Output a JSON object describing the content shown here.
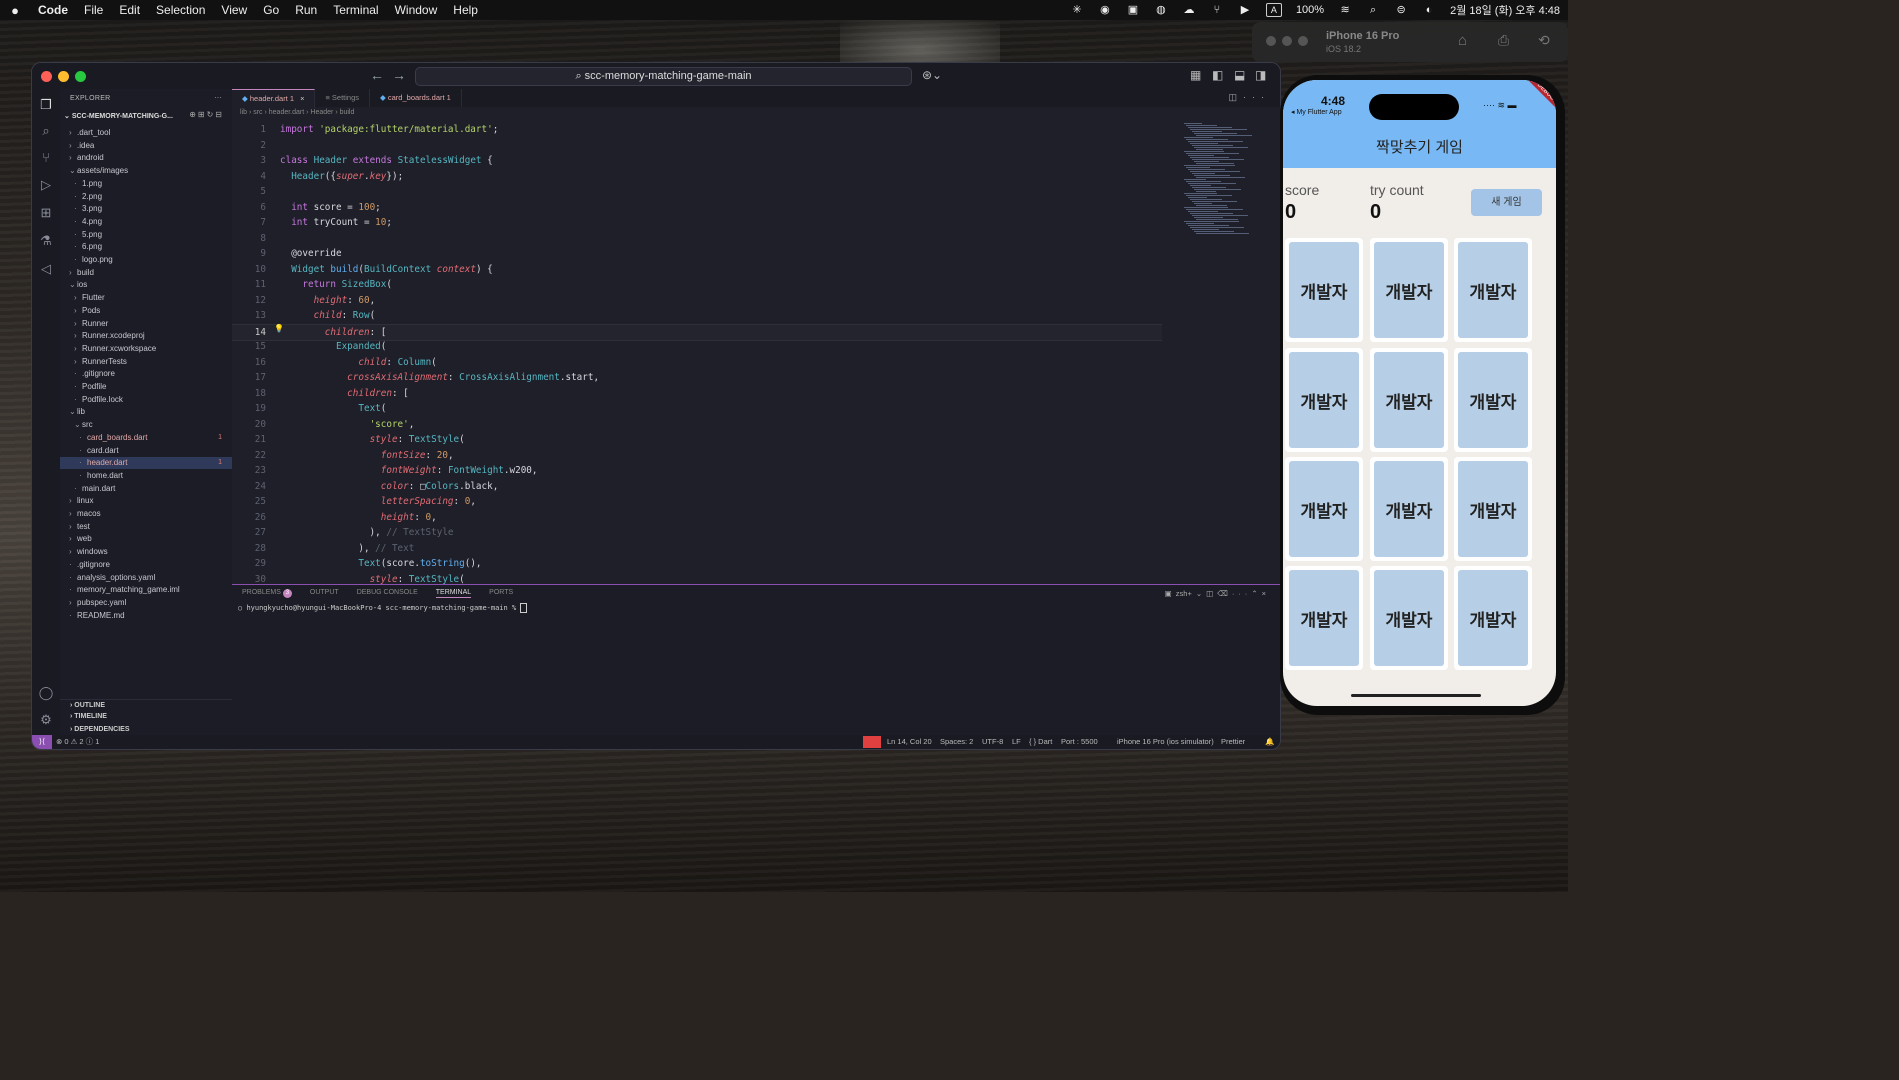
{
  "menubar": {
    "apple": "",
    "items": [
      "Code",
      "File",
      "Edit",
      "Selection",
      "View",
      "Go",
      "Run",
      "Terminal",
      "Window",
      "Help"
    ],
    "battery": "100%",
    "input_mode": "A",
    "datetime": "2월 18일 (화) 오후 4:48"
  },
  "vscode": {
    "command_center": "scc-memory-matching-game-main",
    "explorer_title": "EXPLORER",
    "project": "SCC-MEMORY-MATCHING-G...",
    "tree": [
      {
        "label": ".dart_tool",
        "indent": 1,
        "twisty": "›"
      },
      {
        "label": ".idea",
        "indent": 1,
        "twisty": "›"
      },
      {
        "label": "android",
        "indent": 1,
        "twisty": "›"
      },
      {
        "label": "assets/images",
        "indent": 1,
        "twisty": "⌄"
      },
      {
        "label": "1.png",
        "indent": 2,
        "twisty": ""
      },
      {
        "label": "2.png",
        "indent": 2,
        "twisty": ""
      },
      {
        "label": "3.png",
        "indent": 2,
        "twisty": ""
      },
      {
        "label": "4.png",
        "indent": 2,
        "twisty": ""
      },
      {
        "label": "5.png",
        "indent": 2,
        "twisty": ""
      },
      {
        "label": "6.png",
        "indent": 2,
        "twisty": ""
      },
      {
        "label": "logo.png",
        "indent": 2,
        "twisty": ""
      },
      {
        "label": "build",
        "indent": 1,
        "twisty": "›"
      },
      {
        "label": "ios",
        "indent": 1,
        "twisty": "⌄"
      },
      {
        "label": "Flutter",
        "indent": 2,
        "twisty": "›"
      },
      {
        "label": "Pods",
        "indent": 2,
        "twisty": "›"
      },
      {
        "label": "Runner",
        "indent": 2,
        "twisty": "›"
      },
      {
        "label": "Runner.xcodeproj",
        "indent": 2,
        "twisty": "›"
      },
      {
        "label": "Runner.xcworkspace",
        "indent": 2,
        "twisty": "›"
      },
      {
        "label": "RunnerTests",
        "indent": 2,
        "twisty": "›"
      },
      {
        "label": ".gitignore",
        "indent": 2,
        "twisty": ""
      },
      {
        "label": "Podfile",
        "indent": 2,
        "twisty": ""
      },
      {
        "label": "Podfile.lock",
        "indent": 2,
        "twisty": ""
      },
      {
        "label": "lib",
        "indent": 1,
        "twisty": "⌄"
      },
      {
        "label": "src",
        "indent": 2,
        "twisty": "⌄"
      },
      {
        "label": "card_boards.dart",
        "indent": 3,
        "twisty": "",
        "badge": "1"
      },
      {
        "label": "card.dart",
        "indent": 3,
        "twisty": ""
      },
      {
        "label": "header.dart",
        "indent": 3,
        "twisty": "",
        "badge": "1",
        "selected": true
      },
      {
        "label": "home.dart",
        "indent": 3,
        "twisty": ""
      },
      {
        "label": "main.dart",
        "indent": 2,
        "twisty": ""
      },
      {
        "label": "linux",
        "indent": 1,
        "twisty": "›"
      },
      {
        "label": "macos",
        "indent": 1,
        "twisty": "›"
      },
      {
        "label": "test",
        "indent": 1,
        "twisty": "›"
      },
      {
        "label": "web",
        "indent": 1,
        "twisty": "›"
      },
      {
        "label": "windows",
        "indent": 1,
        "twisty": "›"
      },
      {
        "label": ".gitignore",
        "indent": 1,
        "twisty": ""
      },
      {
        "label": "analysis_options.yaml",
        "indent": 1,
        "twisty": ""
      },
      {
        "label": "memory_matching_game.iml",
        "indent": 1,
        "twisty": ""
      },
      {
        "label": "pubspec.yaml",
        "indent": 1,
        "twisty": "›"
      },
      {
        "label": "README.md",
        "indent": 1,
        "twisty": ""
      }
    ],
    "sections": [
      "OUTLINE",
      "TIMELINE",
      "DEPENDENCIES"
    ],
    "tabs": [
      {
        "label": "header.dart 1",
        "active": true
      },
      {
        "label": "Settings",
        "active": false
      },
      {
        "label": "card_boards.dart 1",
        "active": false
      }
    ],
    "breadcrumb": "lib › src › header.dart › Header › build",
    "code": [
      [
        [
          "kw",
          "import "
        ],
        [
          "st",
          "'package:flutter/material.dart'"
        ],
        [
          "tx",
          ";"
        ]
      ],
      [],
      [
        [
          "kw",
          "class "
        ],
        [
          "ty",
          "Header "
        ],
        [
          "kw",
          "extends "
        ],
        [
          "ty",
          "StatelessWidget "
        ],
        [
          "tx",
          "{"
        ]
      ],
      [
        [
          "tx",
          "  "
        ],
        [
          "ty",
          "Header"
        ],
        [
          "tx",
          "({"
        ],
        [
          "pa",
          "super"
        ],
        [
          "tx",
          "."
        ],
        [
          "pa",
          "key"
        ],
        [
          "tx",
          "});"
        ]
      ],
      [],
      [
        [
          "tx",
          "  "
        ],
        [
          "kw",
          "int "
        ],
        [
          "tx",
          "score = "
        ],
        [
          "nu",
          "100"
        ],
        [
          "tx",
          ";"
        ]
      ],
      [
        [
          "tx",
          "  "
        ],
        [
          "kw",
          "int "
        ],
        [
          "tx",
          "tryCount = "
        ],
        [
          "nu",
          "10"
        ],
        [
          "tx",
          ";"
        ]
      ],
      [],
      [
        [
          "tx",
          "  @override"
        ]
      ],
      [
        [
          "tx",
          "  "
        ],
        [
          "ty",
          "Widget "
        ],
        [
          "fn",
          "build"
        ],
        [
          "tx",
          "("
        ],
        [
          "ty",
          "BuildContext "
        ],
        [
          "pa",
          "context"
        ],
        [
          "tx",
          ") {"
        ]
      ],
      [
        [
          "tx",
          "    "
        ],
        [
          "kw",
          "return "
        ],
        [
          "ty",
          "SizedBox"
        ],
        [
          "tx",
          "("
        ]
      ],
      [
        [
          "tx",
          "      "
        ],
        [
          "pa",
          "height"
        ],
        [
          "tx",
          ": "
        ],
        [
          "nu",
          "60"
        ],
        [
          "tx",
          ","
        ]
      ],
      [
        [
          "tx",
          "      "
        ],
        [
          "pa",
          "child"
        ],
        [
          "tx",
          ": "
        ],
        [
          "ty",
          "Row"
        ],
        [
          "tx",
          "("
        ]
      ],
      [
        [
          "tx",
          "        "
        ],
        [
          "pa",
          "children"
        ],
        [
          "tx",
          ": ["
        ]
      ],
      [
        [
          "tx",
          "          "
        ],
        [
          "ty",
          "Expanded"
        ],
        [
          "tx",
          "("
        ]
      ],
      [
        [
          "tx",
          "              "
        ],
        [
          "pa",
          "child"
        ],
        [
          "tx",
          ": "
        ],
        [
          "ty",
          "Column"
        ],
        [
          "tx",
          "("
        ]
      ],
      [
        [
          "tx",
          "            "
        ],
        [
          "pa",
          "crossAxisAlignment"
        ],
        [
          "tx",
          ": "
        ],
        [
          "ty",
          "CrossAxisAlignment"
        ],
        [
          "tx",
          ".start,"
        ]
      ],
      [
        [
          "tx",
          "            "
        ],
        [
          "pa",
          "children"
        ],
        [
          "tx",
          ": ["
        ]
      ],
      [
        [
          "tx",
          "              "
        ],
        [
          "ty",
          "Text"
        ],
        [
          "tx",
          "("
        ]
      ],
      [
        [
          "tx",
          "                "
        ],
        [
          "st",
          "'score'"
        ],
        [
          "tx",
          ","
        ]
      ],
      [
        [
          "tx",
          "                "
        ],
        [
          "pa",
          "style"
        ],
        [
          "tx",
          ": "
        ],
        [
          "ty",
          "TextStyle"
        ],
        [
          "tx",
          "("
        ]
      ],
      [
        [
          "tx",
          "                  "
        ],
        [
          "pa",
          "fontSize"
        ],
        [
          "tx",
          ": "
        ],
        [
          "nu",
          "20"
        ],
        [
          "tx",
          ","
        ]
      ],
      [
        [
          "tx",
          "                  "
        ],
        [
          "pa",
          "fontWeight"
        ],
        [
          "tx",
          ": "
        ],
        [
          "ty",
          "FontWeight"
        ],
        [
          "tx",
          ".w200,"
        ]
      ],
      [
        [
          "tx",
          "                  "
        ],
        [
          "pa",
          "color"
        ],
        [
          "tx",
          ": □"
        ],
        [
          "ty",
          "Colors"
        ],
        [
          "tx",
          ".black,"
        ]
      ],
      [
        [
          "tx",
          "                  "
        ],
        [
          "pa",
          "letterSpacing"
        ],
        [
          "tx",
          ": "
        ],
        [
          "nu",
          "0"
        ],
        [
          "tx",
          ","
        ]
      ],
      [
        [
          "tx",
          "                  "
        ],
        [
          "pa",
          "height"
        ],
        [
          "tx",
          ": "
        ],
        [
          "nu",
          "0"
        ],
        [
          "tx",
          ","
        ]
      ],
      [
        [
          "tx",
          "                ), "
        ],
        [
          "cm",
          "// TextStyle"
        ]
      ],
      [
        [
          "tx",
          "              ), "
        ],
        [
          "cm",
          "// Text"
        ]
      ],
      [
        [
          "tx",
          "              "
        ],
        [
          "ty",
          "Text"
        ],
        [
          "tx",
          "(score."
        ],
        [
          "fn",
          "toString"
        ],
        [
          "tx",
          "(),"
        ]
      ],
      [
        [
          "tx",
          "                "
        ],
        [
          "pa",
          "style"
        ],
        [
          "tx",
          ": "
        ],
        [
          "ty",
          "TextStyle"
        ],
        [
          "tx",
          "("
        ]
      ]
    ],
    "current_line": 14,
    "panel_tabs": [
      "PROBLEMS",
      "OUTPUT",
      "DEBUG CONSOLE",
      "TERMINAL",
      "PORTS"
    ],
    "problems_count": "3",
    "terminal_shell": "zsh",
    "terminal_prompt": "hyungkyucho@hyungui-MacBookPro-4 scc-memory-matching-game-main % ",
    "status": {
      "problems": "⊗ 0 ⚠ 2 ⓘ 1",
      "position": "Ln 14, Col 20",
      "spaces": "Spaces: 2",
      "encoding": "UTF-8",
      "eol": "LF",
      "language": "{ } Dart",
      "port": "Port : 5500",
      "device": "iPhone 16 Pro (ios simulator)",
      "prettier": "Prettier"
    }
  },
  "simulator": {
    "device_name": "iPhone 16 Pro",
    "os": "iOS 18.2",
    "time": "4:48",
    "back_label": "◂ My Flutter App",
    "debug": "DEBUG",
    "app_title": "짝맞추기 게임",
    "score_label": "score",
    "score_value": "0",
    "try_label": "try count",
    "try_value": "0",
    "new_game": "새 게임",
    "card_logo": "개발자"
  }
}
